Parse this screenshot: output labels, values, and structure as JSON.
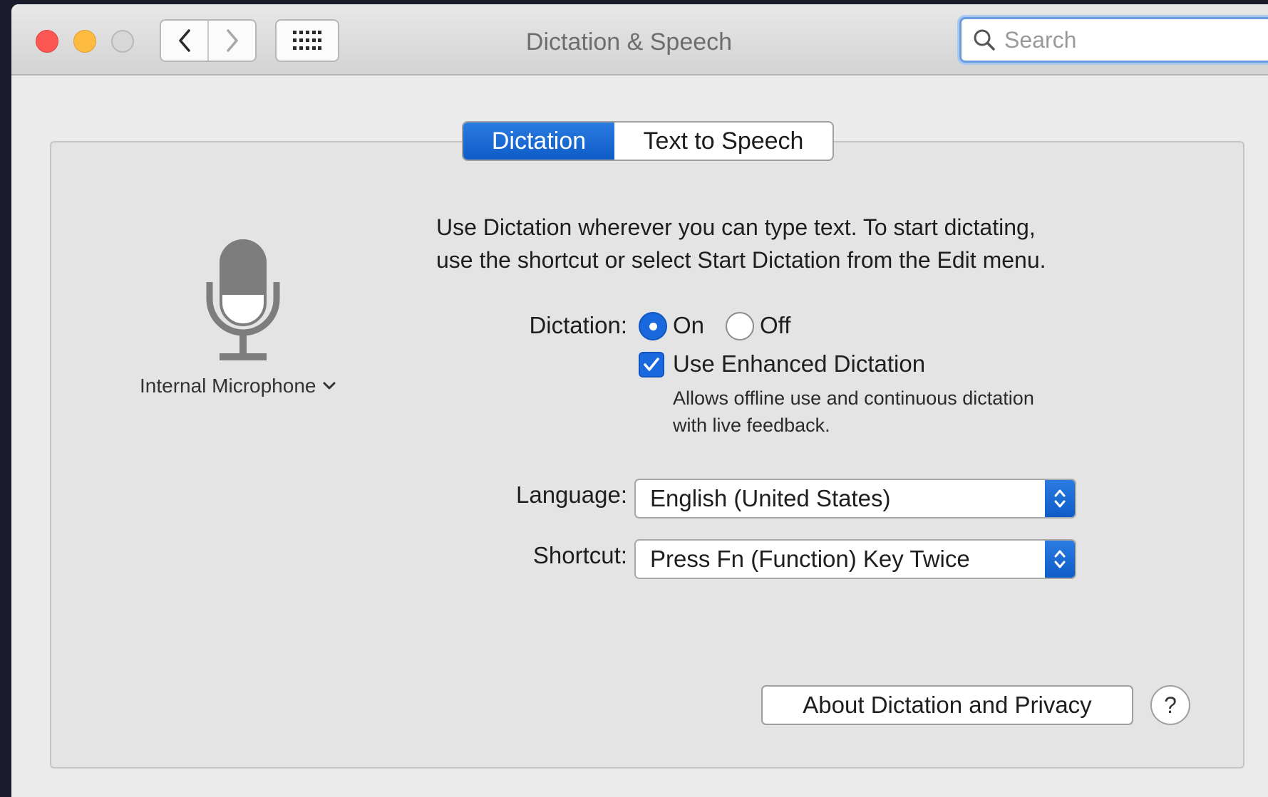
{
  "window": {
    "title": "Dictation & Speech"
  },
  "search": {
    "placeholder": "Search"
  },
  "tabs": [
    {
      "label": "Dictation",
      "active": true
    },
    {
      "label": "Text to Speech",
      "active": false
    }
  ],
  "microphone": {
    "label": "Internal Microphone"
  },
  "description": {
    "line1": "Use Dictation wherever you can type text. To start dictating,",
    "line2": "use the shortcut or select Start Dictation from the Edit menu."
  },
  "dictation": {
    "label": "Dictation:",
    "on_label": "On",
    "off_label": "Off",
    "selected": "On"
  },
  "enhanced": {
    "label": "Use Enhanced Dictation",
    "checked": true,
    "help_line1": "Allows offline use and continuous dictation",
    "help_line2": "with live feedback."
  },
  "language": {
    "label": "Language:",
    "value": "English (United States)"
  },
  "shortcut": {
    "label": "Shortcut:",
    "value": "Press Fn (Function) Key Twice"
  },
  "buttons": {
    "about": "About Dictation and Privacy",
    "help": "?"
  },
  "colors": {
    "accent": "#1968dd",
    "close": "#fc5753",
    "minimize": "#fdbc40",
    "zoom_disabled": "#d7d7d7"
  }
}
